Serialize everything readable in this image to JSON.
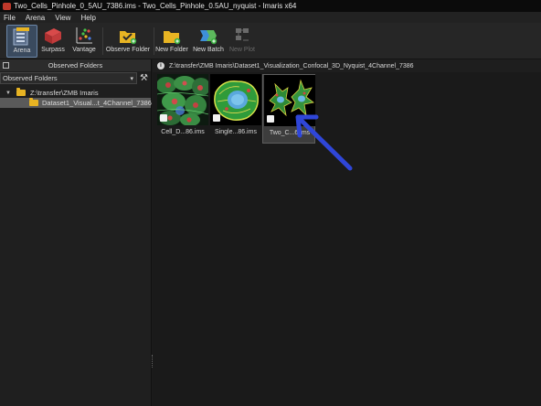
{
  "window": {
    "title": "Two_Cells_Pinhole_0_5AU_7386.ims - Two_Cells_Pinhole_0.5AU_nyquist - Imaris x64"
  },
  "menu": [
    "File",
    "Arena",
    "View",
    "Help"
  ],
  "toolbar": {
    "arena": "Arena",
    "surpass": "Surpass",
    "vantage": "Vantage",
    "observe_folder": "Observe Folder",
    "new_folder": "New Folder",
    "new_batch": "New Batch",
    "new_plot": "New Plot"
  },
  "left_panel": {
    "header": "Observed Folders",
    "dropdown_value": "Observed Folders",
    "tree": [
      {
        "label": "Z:\\transfer\\ZMB Imaris",
        "expanded": true
      },
      {
        "label": "Dataset1_Visual...t_4Channel_7386",
        "selected": true
      }
    ]
  },
  "right_panel": {
    "path": "Z:\\transfer\\ZMB Imaris\\Dataset1_Visualization_Confocal_3D_Nyquist_4Channel_7386",
    "thumbnails": [
      {
        "name": "Cell_D...86.ims",
        "selected": false
      },
      {
        "name": "Single...86.ims",
        "selected": false
      },
      {
        "name": "Two_C...6.ims",
        "selected": true
      }
    ]
  },
  "annotation": {
    "arrow_color": "#2f46d8"
  },
  "colors": {
    "accent": "#e8b423",
    "selection": "#5a5a5a"
  }
}
